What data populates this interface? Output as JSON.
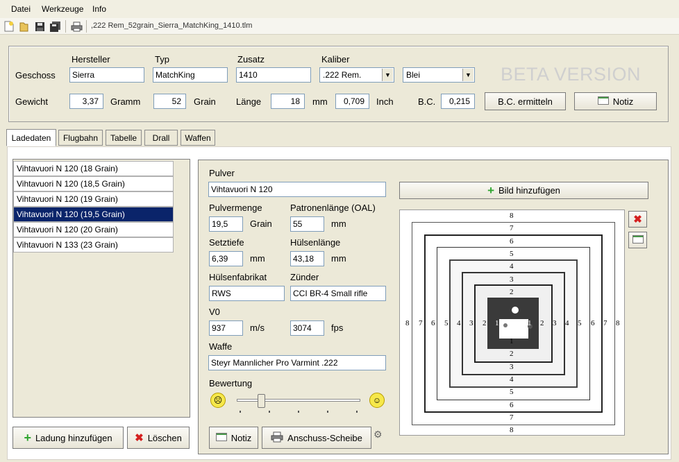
{
  "menu": [
    "Datei",
    "Werkzeuge",
    "Info"
  ],
  "toolbar": {
    "file_path": ",222 Rem_52grain_Sierra_MatchKing_1410.tlm"
  },
  "header": {
    "col_hersteller": "Hersteller",
    "col_typ": "Typ",
    "col_zusatz": "Zusatz",
    "col_kaliber": "Kaliber",
    "geschoss_label": "Geschoss",
    "hersteller": "Sierra",
    "typ": "MatchKing",
    "zusatz": "1410",
    "kaliber": ".222 Rem.",
    "material": "Blei",
    "beta": "BETA VERSION",
    "gewicht_label": "Gewicht",
    "gewicht_gramm": "3,37",
    "gramm_label": "Gramm",
    "gewicht_grain": "52",
    "grain_label": "Grain",
    "laenge_label": "Länge",
    "laenge_mm": "18",
    "mm_label": "mm",
    "laenge_inch": "0,709",
    "inch_label": "Inch",
    "bc_label": "B.C.",
    "bc_value": "0,215",
    "bc_button": "B.C. ermitteln",
    "notiz_button": "Notiz"
  },
  "tabs": [
    "Ladedaten",
    "Flugbahn",
    "Tabelle",
    "Drall",
    "Waffen"
  ],
  "loads": [
    "Vihtavuori N 120 (18 Grain)",
    "Vihtavuori N 120 (18,5 Grain)",
    "Vihtavuori N 120 (19 Grain)",
    "Vihtavuori N 120 (19,5 Grain)",
    "Vihtavuori N 120 (20 Grain)",
    "Vihtavuori N 133 (23 Grain)"
  ],
  "left_buttons": {
    "add": "Ladung hinzufügen",
    "delete": "Löschen"
  },
  "detail": {
    "pulver_label": "Pulver",
    "pulver": "Vihtavuori N 120",
    "pulvermenge_label": "Pulvermenge",
    "pulvermenge": "19,5",
    "grain_unit": "Grain",
    "oal_label": "Patronenlänge (OAL)",
    "oal": "55",
    "mm_unit": "mm",
    "setztiefe_label": "Setztiefe",
    "setztiefe": "6,39",
    "huelsenlaenge_label": "Hülsenlänge",
    "huelsenlaenge": "43,18",
    "huelsenfabrikat_label": "Hülsenfabrikat",
    "huelsenfabrikat": "RWS",
    "zuender_label": "Zünder",
    "zuender": "CCI BR-4 Small rifle",
    "v0_label": "V0",
    "v0_ms": "937",
    "ms_unit": "m/s",
    "v0_fps": "3074",
    "fps_unit": "fps",
    "waffe_label": "Waffe",
    "waffe": "Steyr Mannlicher Pro Varmint .222",
    "bewertung_label": "Bewertung",
    "bewertung_level": 0.2,
    "notiz_button": "Notiz",
    "anschuss_button": "Anschuss-Scheibe",
    "bild_button": "Bild hinzufügen"
  },
  "target": {
    "top_numbers": [
      "8",
      "7",
      "6",
      "5",
      "4",
      "3",
      "2"
    ],
    "bottom_numbers": [
      "1",
      "2",
      "3",
      "4",
      "5",
      "6",
      "7",
      "8"
    ],
    "left_numbers": [
      "8",
      "7",
      "6",
      "5",
      "4",
      "3",
      "2",
      "1"
    ],
    "right_numbers": [
      "1",
      "2",
      "3",
      "4",
      "5",
      "6",
      "7",
      "8"
    ]
  },
  "colors": {
    "selection": "#0a246a",
    "accent_green": "#2fa52f",
    "delete_red": "#d42020"
  }
}
